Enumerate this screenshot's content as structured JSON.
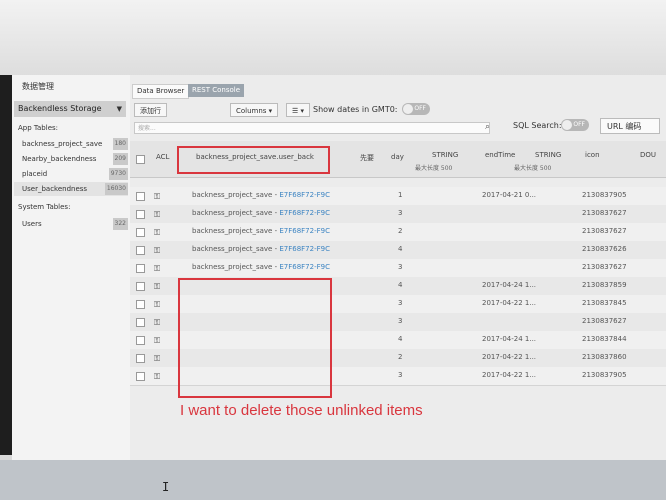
{
  "sidebar": {
    "title": "数据管理",
    "storage": "Backendless Storage",
    "app_tables_label": "App Tables:",
    "tables": [
      {
        "name": "backness_project_save",
        "count": "180"
      },
      {
        "name": "Nearby_backendness",
        "count": "209"
      },
      {
        "name": "placeid",
        "count": "9730"
      },
      {
        "name": "User_backendness",
        "count": "16030"
      }
    ],
    "system_tables_label": "System Tables:",
    "system_tables": [
      {
        "name": "Users",
        "count": "322"
      }
    ]
  },
  "tabs": {
    "data_browser": "Data Browser",
    "rest_console": "REST Console"
  },
  "toolbar": {
    "new_row": "添加行",
    "columns": "Columns ▾",
    "show_dates": "Show dates in GMT0:",
    "toggle_off": "OFF"
  },
  "search": {
    "placeholder": "搜索..."
  },
  "sql_search": {
    "label": "SQL Search:",
    "toggle": "OFF"
  },
  "url_button": "URL 编码",
  "grid": {
    "headers": {
      "acl": "ACL",
      "link_col": "backness_project_save.user_back",
      "x": "先要",
      "day": "day",
      "string1": "STRING",
      "string1_sub": "最大长度 500",
      "endtime": "endTime",
      "string2": "STRING",
      "string2_sub": "最大长度 500",
      "icon": "icon",
      "dou": "DOU"
    },
    "rows": [
      {
        "link": "backness_project_save",
        "id": "E7F68F72-F9C",
        "day": "1",
        "end": "2017-04-21 0...",
        "icon": "2130837905"
      },
      {
        "link": "backness_project_save",
        "id": "E7F68F72-F9C",
        "day": "3",
        "end": "",
        "icon": "2130837627"
      },
      {
        "link": "backness_project_save",
        "id": "E7F68F72-F9C",
        "day": "2",
        "end": "",
        "icon": "2130837627"
      },
      {
        "link": "backness_project_save",
        "id": "E7F68F72-F9C",
        "day": "4",
        "end": "",
        "icon": "2130837626"
      },
      {
        "link": "backness_project_save",
        "id": "E7F68F72-F9C",
        "day": "3",
        "end": "",
        "icon": "2130837627"
      },
      {
        "link": "",
        "id": "",
        "day": "4",
        "end": "2017-04-24 1...",
        "icon": "2130837859"
      },
      {
        "link": "",
        "id": "",
        "day": "3",
        "end": "2017-04-22 1...",
        "icon": "2130837845"
      },
      {
        "link": "",
        "id": "",
        "day": "3",
        "end": "",
        "icon": "2130837627"
      },
      {
        "link": "",
        "id": "",
        "day": "4",
        "end": "2017-04-24 1...",
        "icon": "2130837844"
      },
      {
        "link": "",
        "id": "",
        "day": "2",
        "end": "2017-04-22 1...",
        "icon": "2130837860"
      },
      {
        "link": "",
        "id": "",
        "day": "3",
        "end": "2017-04-22 1...",
        "icon": "2130837905"
      }
    ]
  },
  "annotation": "I want to delete those unlinked items",
  "colors": {
    "annotation_red": "#d9363e",
    "link_blue": "#3c84c2"
  }
}
